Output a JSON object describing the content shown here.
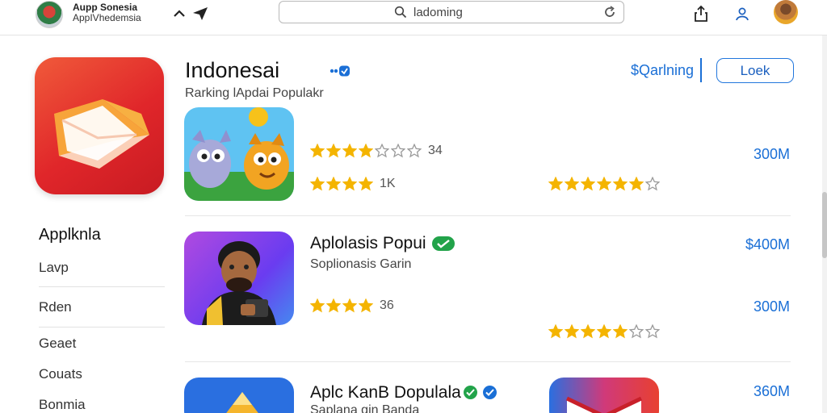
{
  "topbar": {
    "app_title": "Aupp Sonesia",
    "app_subtitle": "AppIVhedemsia",
    "search_value": "ladoming",
    "search_placeholder": "ladoming"
  },
  "header": {
    "title": "Indonesai",
    "subtitle": "Rarking lApdai Populakr",
    "ranking_link": "$Qarlning",
    "look_button": "Loek"
  },
  "sidebar": {
    "heading": "Applknla",
    "items": [
      "Lavp",
      "Rden",
      "Geaet",
      "Couats",
      "Bonmia"
    ]
  },
  "rows": [
    {
      "name": "",
      "subtitle": "",
      "rating_primary": {
        "stars": 4,
        "of": 7,
        "text": "34"
      },
      "rating_secondary": {
        "stars": 4,
        "text": "1K"
      },
      "rating_right": {
        "stars": 6,
        "of": 7
      },
      "count_top": "300M",
      "count_bottom": ""
    },
    {
      "name": "Aplolasis Popui",
      "subtitle": "Soplionasis Garin",
      "rating_primary": {
        "stars": 4,
        "text": "36"
      },
      "rating_right": {
        "stars": 5,
        "of": 7
      },
      "count_top": "$400M",
      "count_bottom": "300M"
    },
    {
      "name": "Aplc KanB Dopulala",
      "subtitle": "Saplana gin Banda",
      "count_top": "360M"
    }
  ],
  "colors": {
    "accent": "#1a6fd6",
    "star": "#f4b400",
    "star_empty": "#9a9a9a",
    "badge_green": "#22a34a",
    "app_icon_red": "#e0262a"
  },
  "icons": [
    "search-icon",
    "reload-icon",
    "share-icon",
    "account-icon",
    "chevron-up-icon",
    "send-icon",
    "verified-badge-icon",
    "star-icon"
  ]
}
